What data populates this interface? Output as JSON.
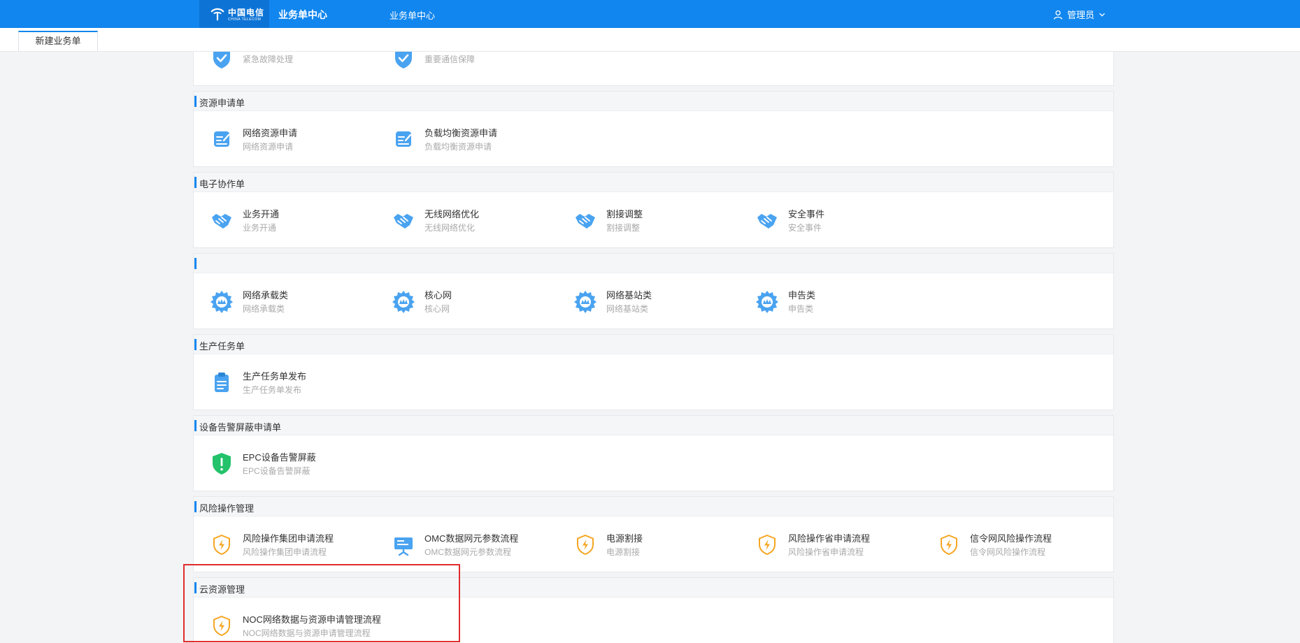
{
  "header": {
    "logo_text": "中国电信",
    "logo_sub": "CHINA TELECOM",
    "app_title": "业务单中心",
    "nav_center": "业务单中心",
    "user_name": "管理员"
  },
  "tabs": [
    {
      "label": "新建业务单"
    }
  ],
  "colors": {
    "primary": "#1186ee",
    "highlight": "#e02d2d"
  },
  "sections": [
    {
      "title": "",
      "items": [
        {
          "name": "",
          "desc": "紧急故障处理",
          "icon": "shield-check-icon"
        },
        {
          "name": "",
          "desc": "重要通信保障",
          "icon": "shield-check-icon"
        }
      ]
    },
    {
      "title": "资源申请单",
      "items": [
        {
          "name": "网络资源申请",
          "desc": "网络资源申请",
          "icon": "edit-form-icon"
        },
        {
          "name": "负载均衡资源申请",
          "desc": "负载均衡资源申请",
          "icon": "edit-form-icon"
        }
      ]
    },
    {
      "title": "电子协作单",
      "items": [
        {
          "name": "业务开通",
          "desc": "业务开通",
          "icon": "handshake-icon"
        },
        {
          "name": "无线网络优化",
          "desc": "无线网络优化",
          "icon": "handshake-icon"
        },
        {
          "name": "割接调整",
          "desc": "割接调整",
          "icon": "handshake-icon"
        },
        {
          "name": "安全事件",
          "desc": "安全事件",
          "icon": "handshake-icon"
        }
      ]
    },
    {
      "title": "",
      "items": [
        {
          "name": "网络承载类",
          "desc": "网络承载类",
          "icon": "gear-icon"
        },
        {
          "name": "核心网",
          "desc": "核心网",
          "icon": "gear-icon"
        },
        {
          "name": "网络基站类",
          "desc": "网络基站类",
          "icon": "gear-icon"
        },
        {
          "name": "申告类",
          "desc": "申告类",
          "icon": "gear-icon"
        }
      ]
    },
    {
      "title": "生产任务单",
      "items": [
        {
          "name": "生产任务单发布",
          "desc": "生产任务单发布",
          "icon": "clipboard-icon"
        }
      ]
    },
    {
      "title": "设备告警屏蔽申请单",
      "items": [
        {
          "name": "EPC设备告警屏蔽",
          "desc": "EPC设备告警屏蔽",
          "icon": "shield-alert-icon"
        }
      ]
    },
    {
      "title": "风险操作管理",
      "items": [
        {
          "name": "风险操作集团申请流程",
          "desc": "风险操作集团申请流程",
          "icon": "shield-bolt-icon"
        },
        {
          "name": "OMC数据网元参数流程",
          "desc": "OMC数据网元参数流程",
          "icon": "presentation-icon"
        },
        {
          "name": "电源割接",
          "desc": "电源割接",
          "icon": "shield-bolt-icon"
        },
        {
          "name": "风险操作省申请流程",
          "desc": "风险操作省申请流程",
          "icon": "shield-bolt-icon"
        },
        {
          "name": "信令网风险操作流程",
          "desc": "信令网风险操作流程",
          "icon": "shield-bolt-icon"
        }
      ]
    },
    {
      "title": "云资源管理",
      "items": [
        {
          "name": "NOC网络数据与资源申请管理流程",
          "desc": "NOC网络数据与资源申请管理流程",
          "icon": "shield-bolt-icon"
        }
      ]
    }
  ]
}
